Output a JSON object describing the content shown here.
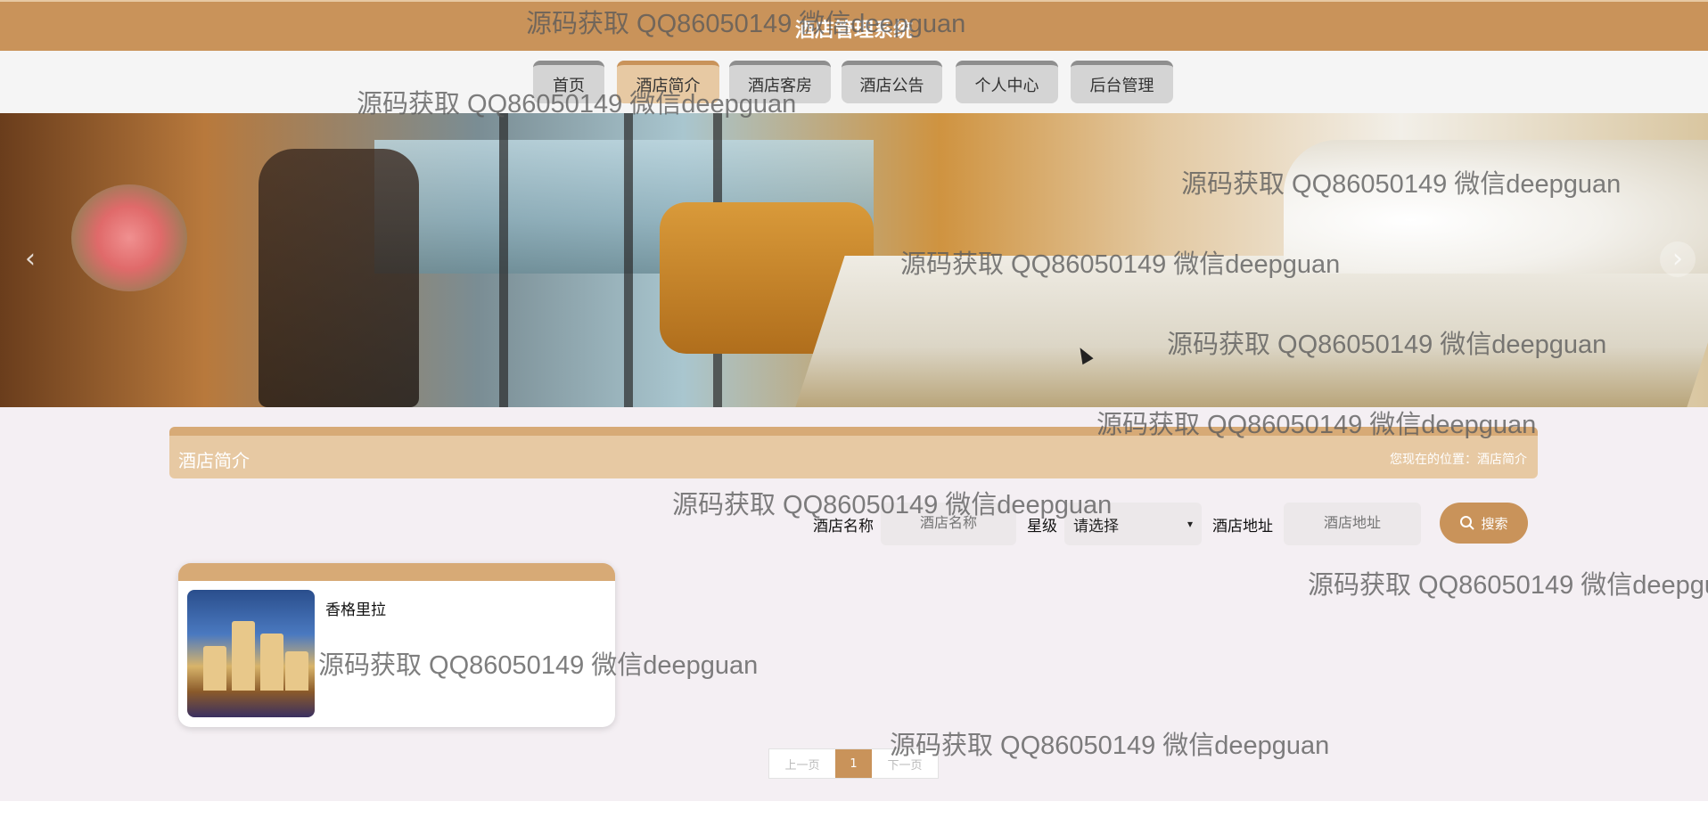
{
  "header": {
    "title": "酒店管理系统"
  },
  "nav": {
    "items": [
      {
        "label": "首页",
        "active": false
      },
      {
        "label": "酒店简介",
        "active": true
      },
      {
        "label": "酒店客房",
        "active": false
      },
      {
        "label": "酒店公告",
        "active": false
      },
      {
        "label": "个人中心",
        "active": false
      },
      {
        "label": "后台管理",
        "active": false
      }
    ]
  },
  "banner": {
    "prev_icon": "chevron-left-icon",
    "next_icon": "chevron-right-icon"
  },
  "section": {
    "title": "酒店简介",
    "breadcrumb": "您现在的位置：酒店简介"
  },
  "search": {
    "name_label": "酒店名称",
    "name_placeholder": "酒店名称",
    "star_label": "星级",
    "star_selected": "请选择",
    "address_label": "酒店地址",
    "address_placeholder": "酒店地址",
    "button_label": "搜索"
  },
  "hotels": [
    {
      "name": "香格里拉"
    }
  ],
  "pagination": {
    "prev": "上一页",
    "current": "1",
    "next": "下一页"
  },
  "watermark": {
    "text": "源码获取 QQ86050149 微信deepguan"
  },
  "colors": {
    "accent": "#c9935a",
    "accent_light": "#e7c9a3",
    "content_bg": "#f4eff3"
  }
}
